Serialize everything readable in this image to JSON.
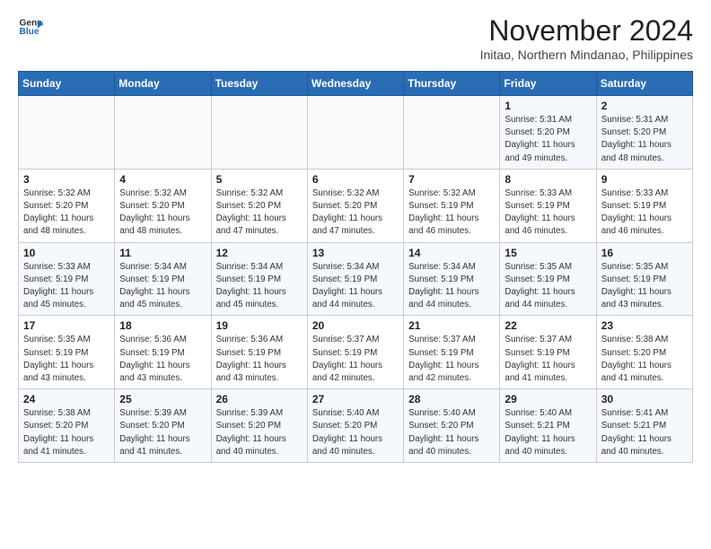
{
  "header": {
    "logo_line1": "General",
    "logo_line2": "Blue",
    "month_year": "November 2024",
    "location": "Initao, Northern Mindanao, Philippines"
  },
  "weekdays": [
    "Sunday",
    "Monday",
    "Tuesday",
    "Wednesday",
    "Thursday",
    "Friday",
    "Saturday"
  ],
  "weeks": [
    [
      {
        "day": "",
        "info": ""
      },
      {
        "day": "",
        "info": ""
      },
      {
        "day": "",
        "info": ""
      },
      {
        "day": "",
        "info": ""
      },
      {
        "day": "",
        "info": ""
      },
      {
        "day": "1",
        "info": "Sunrise: 5:31 AM\nSunset: 5:20 PM\nDaylight: 11 hours\nand 49 minutes."
      },
      {
        "day": "2",
        "info": "Sunrise: 5:31 AM\nSunset: 5:20 PM\nDaylight: 11 hours\nand 48 minutes."
      }
    ],
    [
      {
        "day": "3",
        "info": "Sunrise: 5:32 AM\nSunset: 5:20 PM\nDaylight: 11 hours\nand 48 minutes."
      },
      {
        "day": "4",
        "info": "Sunrise: 5:32 AM\nSunset: 5:20 PM\nDaylight: 11 hours\nand 48 minutes."
      },
      {
        "day": "5",
        "info": "Sunrise: 5:32 AM\nSunset: 5:20 PM\nDaylight: 11 hours\nand 47 minutes."
      },
      {
        "day": "6",
        "info": "Sunrise: 5:32 AM\nSunset: 5:20 PM\nDaylight: 11 hours\nand 47 minutes."
      },
      {
        "day": "7",
        "info": "Sunrise: 5:32 AM\nSunset: 5:19 PM\nDaylight: 11 hours\nand 46 minutes."
      },
      {
        "day": "8",
        "info": "Sunrise: 5:33 AM\nSunset: 5:19 PM\nDaylight: 11 hours\nand 46 minutes."
      },
      {
        "day": "9",
        "info": "Sunrise: 5:33 AM\nSunset: 5:19 PM\nDaylight: 11 hours\nand 46 minutes."
      }
    ],
    [
      {
        "day": "10",
        "info": "Sunrise: 5:33 AM\nSunset: 5:19 PM\nDaylight: 11 hours\nand 45 minutes."
      },
      {
        "day": "11",
        "info": "Sunrise: 5:34 AM\nSunset: 5:19 PM\nDaylight: 11 hours\nand 45 minutes."
      },
      {
        "day": "12",
        "info": "Sunrise: 5:34 AM\nSunset: 5:19 PM\nDaylight: 11 hours\nand 45 minutes."
      },
      {
        "day": "13",
        "info": "Sunrise: 5:34 AM\nSunset: 5:19 PM\nDaylight: 11 hours\nand 44 minutes."
      },
      {
        "day": "14",
        "info": "Sunrise: 5:34 AM\nSunset: 5:19 PM\nDaylight: 11 hours\nand 44 minutes."
      },
      {
        "day": "15",
        "info": "Sunrise: 5:35 AM\nSunset: 5:19 PM\nDaylight: 11 hours\nand 44 minutes."
      },
      {
        "day": "16",
        "info": "Sunrise: 5:35 AM\nSunset: 5:19 PM\nDaylight: 11 hours\nand 43 minutes."
      }
    ],
    [
      {
        "day": "17",
        "info": "Sunrise: 5:35 AM\nSunset: 5:19 PM\nDaylight: 11 hours\nand 43 minutes."
      },
      {
        "day": "18",
        "info": "Sunrise: 5:36 AM\nSunset: 5:19 PM\nDaylight: 11 hours\nand 43 minutes."
      },
      {
        "day": "19",
        "info": "Sunrise: 5:36 AM\nSunset: 5:19 PM\nDaylight: 11 hours\nand 43 minutes."
      },
      {
        "day": "20",
        "info": "Sunrise: 5:37 AM\nSunset: 5:19 PM\nDaylight: 11 hours\nand 42 minutes."
      },
      {
        "day": "21",
        "info": "Sunrise: 5:37 AM\nSunset: 5:19 PM\nDaylight: 11 hours\nand 42 minutes."
      },
      {
        "day": "22",
        "info": "Sunrise: 5:37 AM\nSunset: 5:19 PM\nDaylight: 11 hours\nand 41 minutes."
      },
      {
        "day": "23",
        "info": "Sunrise: 5:38 AM\nSunset: 5:20 PM\nDaylight: 11 hours\nand 41 minutes."
      }
    ],
    [
      {
        "day": "24",
        "info": "Sunrise: 5:38 AM\nSunset: 5:20 PM\nDaylight: 11 hours\nand 41 minutes."
      },
      {
        "day": "25",
        "info": "Sunrise: 5:39 AM\nSunset: 5:20 PM\nDaylight: 11 hours\nand 41 minutes."
      },
      {
        "day": "26",
        "info": "Sunrise: 5:39 AM\nSunset: 5:20 PM\nDaylight: 11 hours\nand 40 minutes."
      },
      {
        "day": "27",
        "info": "Sunrise: 5:40 AM\nSunset: 5:20 PM\nDaylight: 11 hours\nand 40 minutes."
      },
      {
        "day": "28",
        "info": "Sunrise: 5:40 AM\nSunset: 5:20 PM\nDaylight: 11 hours\nand 40 minutes."
      },
      {
        "day": "29",
        "info": "Sunrise: 5:40 AM\nSunset: 5:21 PM\nDaylight: 11 hours\nand 40 minutes."
      },
      {
        "day": "30",
        "info": "Sunrise: 5:41 AM\nSunset: 5:21 PM\nDaylight: 11 hours\nand 40 minutes."
      }
    ]
  ]
}
